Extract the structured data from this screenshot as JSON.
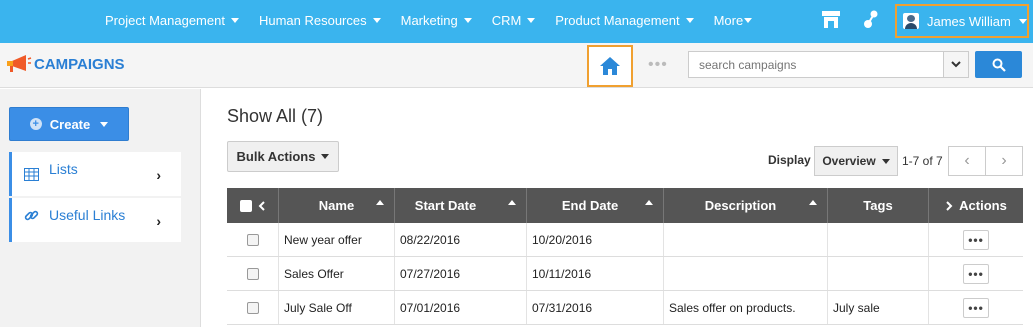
{
  "topnav": {
    "items": [
      {
        "label": "Project Management"
      },
      {
        "label": "Human Resources"
      },
      {
        "label": "Marketing"
      },
      {
        "label": "CRM"
      },
      {
        "label": "Product Management"
      },
      {
        "label": "More"
      }
    ],
    "user_name": "James William"
  },
  "header": {
    "app_title": "CAMPAIGNS",
    "search_placeholder": "search campaigns"
  },
  "sidebar": {
    "create_label": "Create",
    "items": [
      {
        "label": "Lists"
      },
      {
        "label": "Useful Links"
      }
    ]
  },
  "main": {
    "title": "Show All (7)",
    "bulk_actions_label": "Bulk Actions",
    "display_label": "Display",
    "view_label": "Overview",
    "range_label": "1-7 of 7"
  },
  "table": {
    "columns": [
      "Name",
      "Start Date",
      "End Date",
      "Description",
      "Tags",
      "Actions"
    ],
    "rows": [
      {
        "name": "New year offer",
        "start": "08/22/2016",
        "end": "10/20/2016",
        "description": "",
        "tags": ""
      },
      {
        "name": "Sales Offer",
        "start": "07/27/2016",
        "end": "10/11/2016",
        "description": "",
        "tags": ""
      },
      {
        "name": "July Sale Off",
        "start": "07/01/2016",
        "end": "07/31/2016",
        "description": "Sales offer on products.",
        "tags": "July sale"
      }
    ]
  },
  "colors": {
    "topbar": "#3ab4ee",
    "accent": "#2b88d8",
    "highlight": "#f0a030",
    "table_header": "#555555"
  }
}
